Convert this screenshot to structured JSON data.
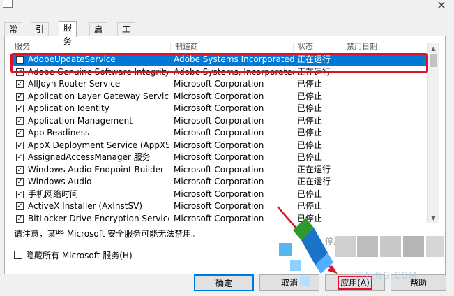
{
  "tabs": [
    "常规",
    "引导",
    "服务",
    "启动",
    "工具"
  ],
  "active_tab": 2,
  "columns": [
    "服务",
    "制造商",
    "状态",
    "禁用日期"
  ],
  "rows": [
    {
      "checked": false,
      "name": "AdobeUpdateService",
      "maker": "Adobe Systems Incorporated",
      "status": "正在运行",
      "selected": true
    },
    {
      "checked": true,
      "name": "Adobe Genuine Software Integrity S...",
      "maker": "Adobe Systems, Incorporated",
      "status": "正在运行"
    },
    {
      "checked": true,
      "name": "AllJoyn Router Service",
      "maker": "Microsoft Corporation",
      "status": "已停止"
    },
    {
      "checked": true,
      "name": "Application Layer Gateway Service",
      "maker": "Microsoft Corporation",
      "status": "已停止"
    },
    {
      "checked": true,
      "name": "Application Identity",
      "maker": "Microsoft Corporation",
      "status": "已停止"
    },
    {
      "checked": true,
      "name": "Application Management",
      "maker": "Microsoft Corporation",
      "status": "已停止"
    },
    {
      "checked": true,
      "name": "App Readiness",
      "maker": "Microsoft Corporation",
      "status": "已停止"
    },
    {
      "checked": true,
      "name": "AppX Deployment Service (AppXSV...",
      "maker": "Microsoft Corporation",
      "status": "已停止"
    },
    {
      "checked": true,
      "name": "AssignedAccessManager 服务",
      "maker": "Microsoft Corporation",
      "status": "已停止"
    },
    {
      "checked": true,
      "name": "Windows Audio Endpoint Builder",
      "maker": "Microsoft Corporation",
      "status": "正在运行"
    },
    {
      "checked": true,
      "name": "Windows Audio",
      "maker": "Microsoft Corporation",
      "status": "正在运行"
    },
    {
      "checked": true,
      "name": "手机网络时间",
      "maker": "Microsoft Corporation",
      "status": "已停止"
    },
    {
      "checked": true,
      "name": "ActiveX Installer (AxInstSV)",
      "maker": "Microsoft Corporation",
      "status": "已停止"
    },
    {
      "checked": true,
      "name": "BitLocker Drive Encryption Service",
      "maker": "Microsoft Corporation",
      "status": "已停止"
    }
  ],
  "note": "请注意，某些 Microsoft 安全服务可能无法禁用。",
  "partial_button": "停用",
  "hide_ms_label": "隐藏所有 Microsoft 服务(H)",
  "buttons": {
    "ok": "确定",
    "cancel": "取消",
    "apply": "应用(A)",
    "help": "帮助"
  },
  "watermark": "CHENG.COM",
  "colors": {
    "highlight": "#e0102a",
    "selection": "#0078d7"
  }
}
